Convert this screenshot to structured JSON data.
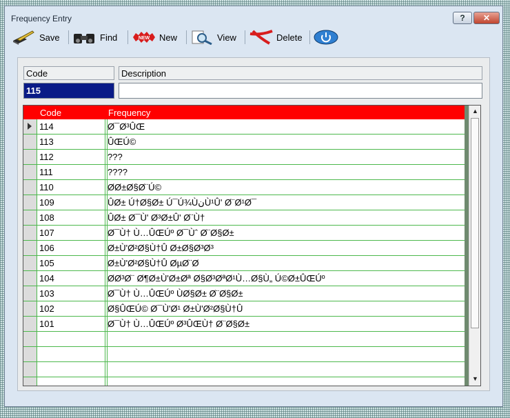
{
  "window": {
    "title": "Frequency Entry",
    "help_label": "?",
    "close_label": "✕"
  },
  "toolbar": {
    "save_label": "Save",
    "find_label": "Find",
    "new_label": "New",
    "view_label": "View",
    "delete_label": "Delete",
    "new_icon_text": "NEW"
  },
  "form": {
    "code_header": "Code",
    "description_header": "Description",
    "code_value": "115",
    "description_value": ""
  },
  "grid": {
    "columns": [
      "Code",
      "Frequency"
    ],
    "header_color": "#ff0000",
    "rows": [
      {
        "code": "114",
        "frequency": "Ø¯Ø³ÛŒ"
      },
      {
        "code": "113",
        "frequency": "ÛŒÚ©"
      },
      {
        "code": "112",
        "frequency": "???"
      },
      {
        "code": "111",
        "frequency": "????"
      },
      {
        "code": "110",
        "frequency": "Ø­Ø±Ø§Ø¨Ú©"
      },
      {
        "code": "109",
        "frequency": "ÛØ± Ú†Ø§Ø± Ú¯Ú¾ÙنÙ¹Û' Ø¨Ø¹Ø¯"
      },
      {
        "code": "108",
        "frequency": "ÛØ± Ø¯Ù' Ø³Ø±Û' Ø¨Ù†"
      },
      {
        "code": "107",
        "frequency": "Ø¯Ù† Ù…ÛŒÚº Ø¯Ùˆ Ø¨Ø§Ø±"
      },
      {
        "code": "106",
        "frequency": "Ø±Ù'Ø²Ø§Ù†Û Ø±Ø§Ø³Ø³"
      },
      {
        "code": "105",
        "frequency": "Ø±Ù'Ø²Ø§Ù†Û ØµØ¨Ø­"
      },
      {
        "code": "104",
        "frequency": "Ø­Ø³Ø¨ Ø¶Ø±Ù'Ø±Øª Ø§Ø³ØªØ¹Ù…Ø§Ù„ Ú©Ø±ÛŒÚº"
      },
      {
        "code": "103",
        "frequency": "Ø¯Ù† Ù…ÛŒÚº ÙØ§Ø± Ø¨Ø§Ø±"
      },
      {
        "code": "102",
        "frequency": "Ø§ÛŒÚ© Ø¯Ù'Ø¹ Ø±Ù'Ø²Ø§Ù†Û"
      },
      {
        "code": "101",
        "frequency": "Ø¯Ù† Ù…ÛŒÚº Ø³ÛŒÙ† Ø¨Ø§Ø±"
      },
      {
        "code": "",
        "frequency": ""
      },
      {
        "code": "",
        "frequency": ""
      },
      {
        "code": "",
        "frequency": ""
      },
      {
        "code": "",
        "frequency": ""
      }
    ]
  },
  "icons": [
    "save-icon",
    "find-icon",
    "new-icon",
    "view-icon",
    "delete-icon",
    "power-icon"
  ]
}
